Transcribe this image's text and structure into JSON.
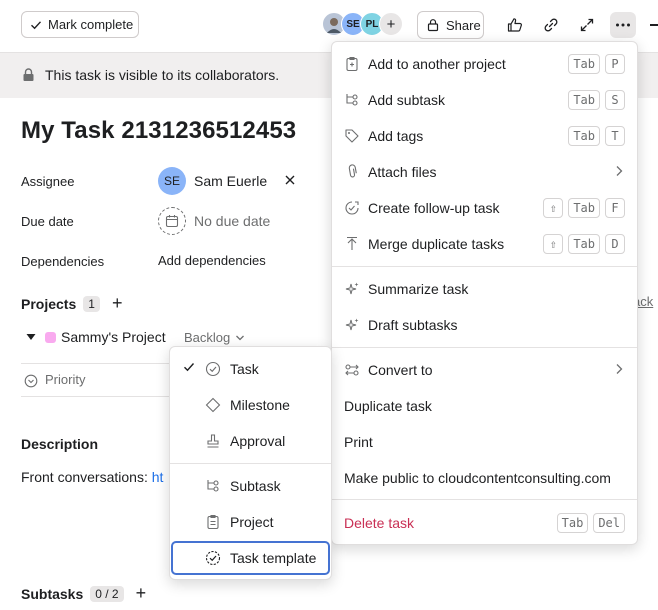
{
  "toolbar": {
    "mark_complete_label": "Mark complete",
    "share_label": "Share",
    "avatars": [
      {
        "initials": "",
        "color": "#b9c4d6"
      },
      {
        "initials": "SE",
        "color": "#8ab4f8"
      },
      {
        "initials": "PL",
        "color": "#7fd3e3"
      }
    ],
    "add_collaborator_symbol": "+"
  },
  "banner": {
    "text": "This task is visible to its collaborators."
  },
  "task": {
    "title": "My Task 2131236512453",
    "fields": {
      "assignee_label": "Assignee",
      "assignee_initials": "SE",
      "assignee_name": "Sam Euerle",
      "due_date_label": "Due date",
      "due_date_value": "No due date",
      "dependencies_label": "Dependencies",
      "dependencies_link": "Add dependencies"
    },
    "projects": {
      "heading": "Projects",
      "count": "1",
      "add_symbol": "+",
      "project_name": "Sammy's Project",
      "section": "Backlog",
      "priority_label": "Priority",
      "right_partial_link": "ack"
    },
    "description": {
      "heading": "Description",
      "text": "Front conversations: ",
      "link": "ht"
    },
    "subtasks": {
      "heading": "Subtasks",
      "count": "0 / 2",
      "add_symbol": "+"
    }
  },
  "more_menu": {
    "items": [
      {
        "label": "Add to another project",
        "keys": [
          "Tab",
          "P"
        ],
        "icon": "add-to-project-icon"
      },
      {
        "label": "Add subtask",
        "keys": [
          "Tab",
          "S"
        ],
        "icon": "subtask-icon"
      },
      {
        "label": "Add tags",
        "keys": [
          "Tab",
          "T"
        ],
        "icon": "tag-icon"
      },
      {
        "label": "Attach files",
        "keys": [],
        "icon": "paperclip-icon",
        "submenu": true
      },
      {
        "label": "Create follow-up task",
        "keys": [
          "⇧",
          "Tab",
          "F"
        ],
        "icon": "follow-up-icon"
      },
      {
        "label": "Merge duplicate tasks",
        "keys": [
          "⇧",
          "Tab",
          "D"
        ],
        "icon": "merge-icon"
      },
      {
        "label": "Summarize task",
        "icon": "sparkle-icon"
      },
      {
        "label": "Draft subtasks",
        "icon": "sparkle-icon"
      },
      {
        "label": "Convert to",
        "icon": "convert-icon",
        "submenu": true
      },
      {
        "label": "Duplicate task"
      },
      {
        "label": "Print"
      },
      {
        "label": "Make public to cloudcontentconsulting.com"
      },
      {
        "label": "Delete task",
        "keys": [
          "Tab",
          "Del"
        ],
        "danger_color": "#c92f54"
      }
    ]
  },
  "convert_menu": {
    "items": [
      {
        "label": "Task",
        "checked": true,
        "icon": "check-circle-icon"
      },
      {
        "label": "Milestone",
        "icon": "diamond-icon"
      },
      {
        "label": "Approval",
        "icon": "approval-stamp-icon"
      },
      {
        "label": "Subtask",
        "icon": "subtask-icon"
      },
      {
        "label": "Project",
        "icon": "clipboard-icon"
      },
      {
        "label": "Task template",
        "icon": "task-template-icon",
        "focused": true
      }
    ]
  },
  "colors": {
    "accent_blue": "#4573d2",
    "link_blue": "#1c6fe8",
    "project_swatch": "#f9aaef",
    "banner_bg": "#f1efef"
  }
}
